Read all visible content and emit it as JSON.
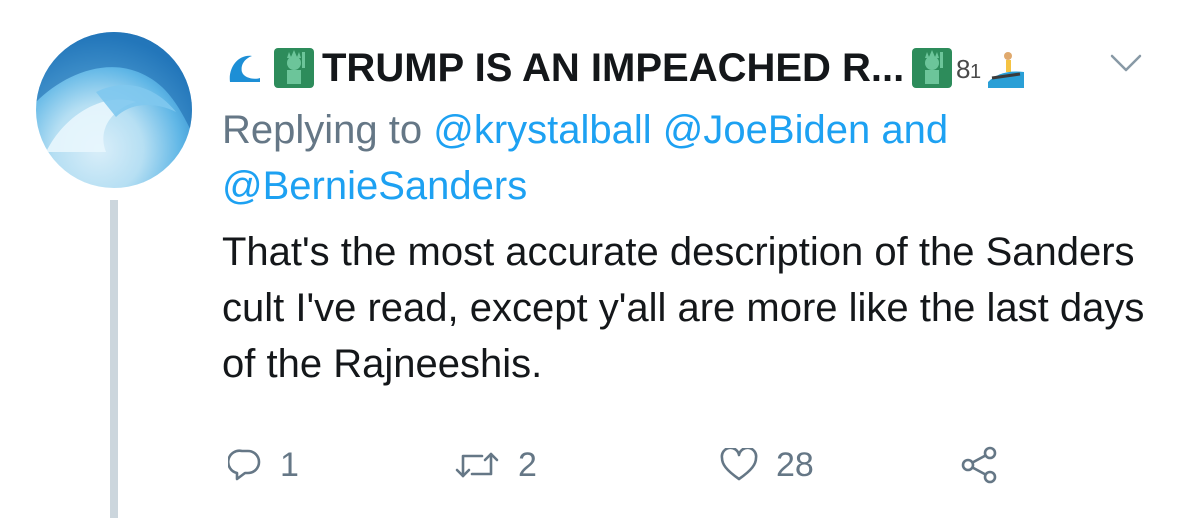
{
  "author": {
    "display_name": "TRUMP IS AN IMPEACHED R...",
    "icons": [
      "wave-icon",
      "statue-of-liberty-icon",
      "statue-of-liberty-icon",
      "number-81-badge-icon",
      "surfer-icon"
    ]
  },
  "reply": {
    "prefix": "Replying to ",
    "mention_1": "@krystalball",
    "mention_2": "@JoeBiden",
    "conjunction": "and",
    "mention_3": "@BernieSanders"
  },
  "tweet": {
    "text": "That's the most accurate description of the Sanders cult I've read, except y'all are more like the last days of the Rajneeshis."
  },
  "actions": {
    "replies": "1",
    "retweets": "2",
    "likes": "28"
  },
  "colors": {
    "link": "#1da1f2",
    "secondary": "#657786",
    "thread_line": "#ccd6dd",
    "emoji_badge": "#2d8c5b"
  }
}
